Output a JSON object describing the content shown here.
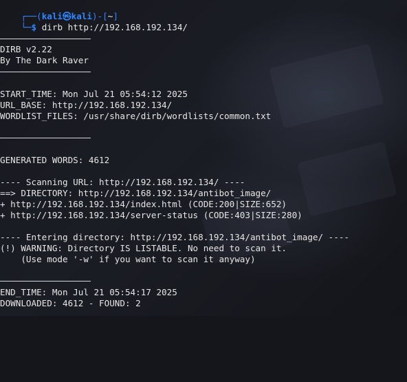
{
  "prompt": {
    "user": "kali",
    "at": "㉿",
    "host": "kali",
    "cwd": "~",
    "dollar": "$",
    "command": "dirb http://192.168.192.134/"
  },
  "banner": {
    "version": "DIRB v2.22",
    "author": "By The Dark Raver"
  },
  "info": {
    "start_time": "START_TIME: Mon Jul 21 05:54:12 2025",
    "url_base": "URL_BASE: http://192.168.192.134/",
    "wordlist": "WORDLIST_FILES: /usr/share/dirb/wordlists/common.txt"
  },
  "generated": "GENERATED WORDS: 4612",
  "scan": {
    "scanning": "---- Scanning URL: http://192.168.192.134/ ----",
    "directory": "==> DIRECTORY: http://192.168.192.134/antibot_image/",
    "hit1": "+ http://192.168.192.134/index.html (CODE:200|SIZE:652)",
    "hit2": "+ http://192.168.192.134/server-status (CODE:403|SIZE:280)"
  },
  "entering": {
    "line": "---- Entering directory: http://192.168.192.134/antibot_image/ ----",
    "warning": "(!) WARNING: Directory IS LISTABLE. No need to scan it.",
    "hint": "    (Use mode '-w' if you want to scan it anyway)"
  },
  "end": {
    "end_time": "END_TIME: Mon Jul 21 05:54:17 2025",
    "downloaded": "DOWNLOADED: 4612 - FOUND: 2"
  },
  "colors": {
    "background": "#15161b",
    "prompt_blue": "#2f86ff",
    "text": "#e6e6e6"
  }
}
